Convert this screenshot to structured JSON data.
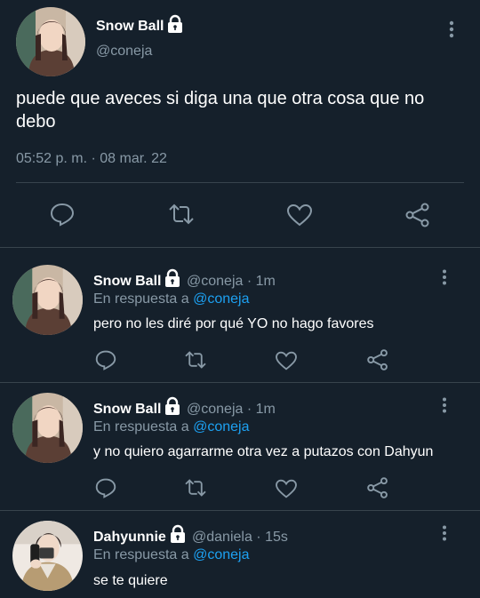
{
  "main_tweet": {
    "display_name": "Snow Ball",
    "handle": "@coneja",
    "text": "puede que aveces si diga una que otra cosa que no debo",
    "timestamp": "05:52 p. m. · 08 mar. 22",
    "protected_icon": "lock-icon",
    "actions": [
      "reply-icon",
      "retweet-icon",
      "like-icon",
      "share-icon"
    ]
  },
  "replies": [
    {
      "display_name": "Snow Ball",
      "handle": "@coneja",
      "time": "· 1m",
      "replying_prefix": "En respuesta a",
      "replying_to": "@coneja",
      "text": "pero no les diré por qué YO no hago favores"
    },
    {
      "display_name": "Snow Ball",
      "handle": "@coneja",
      "time": "· 1m",
      "replying_prefix": "En respuesta a",
      "replying_to": "@coneja",
      "text": "y no quiero agarrarme otra vez a putazos con Dahyun"
    },
    {
      "display_name": "Dahyunnie",
      "handle": "@daniela",
      "time": "· 15s",
      "replying_prefix": "En respuesta a",
      "replying_to": "@coneja",
      "text": "se te quiere"
    }
  ],
  "colors": {
    "background": "#15202b",
    "divider": "#38444d",
    "secondary_text": "#8899a6",
    "accent": "#1da1f2",
    "icon": "#8899a6"
  }
}
